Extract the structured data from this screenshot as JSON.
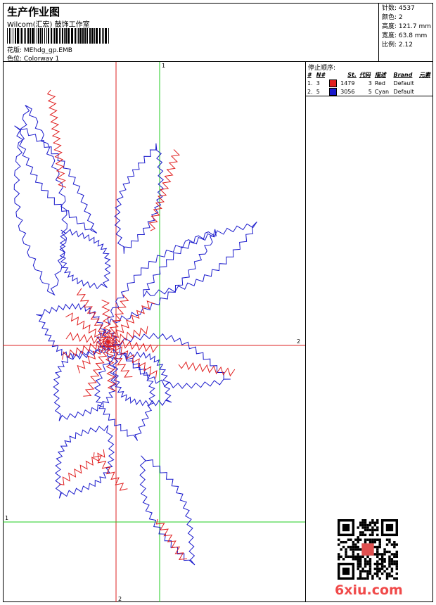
{
  "header": {
    "title": "生产作业图",
    "subtitle": "Wilcom(汇宏) 鼓饰工作室",
    "design_label": "花版: MEhdg_gp.EMB",
    "colorway_label": "色位: Colorway 1"
  },
  "stats": {
    "stitches": "针数: 4537",
    "colors": "颜色: 2",
    "height": "高度: 121.7 mm",
    "width": "宽度: 63.8 mm",
    "ratio": "比例: 2.12"
  },
  "sequence": {
    "title": "停止顺序:",
    "columns": [
      "#",
      "N#",
      "St.",
      "代码",
      "描述",
      "Brand",
      "元素"
    ],
    "rows": [
      {
        "index": "1.",
        "n": "3",
        "color": "#e02020",
        "stitches": "1479",
        "code": "3",
        "desc": "Red",
        "brand": "Default"
      },
      {
        "index": "2.",
        "n": "5",
        "color": "#1a1acc",
        "stitches": "3056",
        "code": "5",
        "desc": "Cyan",
        "brand": "Default"
      }
    ]
  },
  "guides": {
    "v1_label": "1",
    "h1_label": "1",
    "v2_label": "2",
    "h2_label": "2"
  },
  "watermark": "6xiu.com",
  "colors": {
    "red": "#e02020",
    "blue": "#1a1acc",
    "green_guide": "#22cc22",
    "red_guide": "#dd2222"
  }
}
